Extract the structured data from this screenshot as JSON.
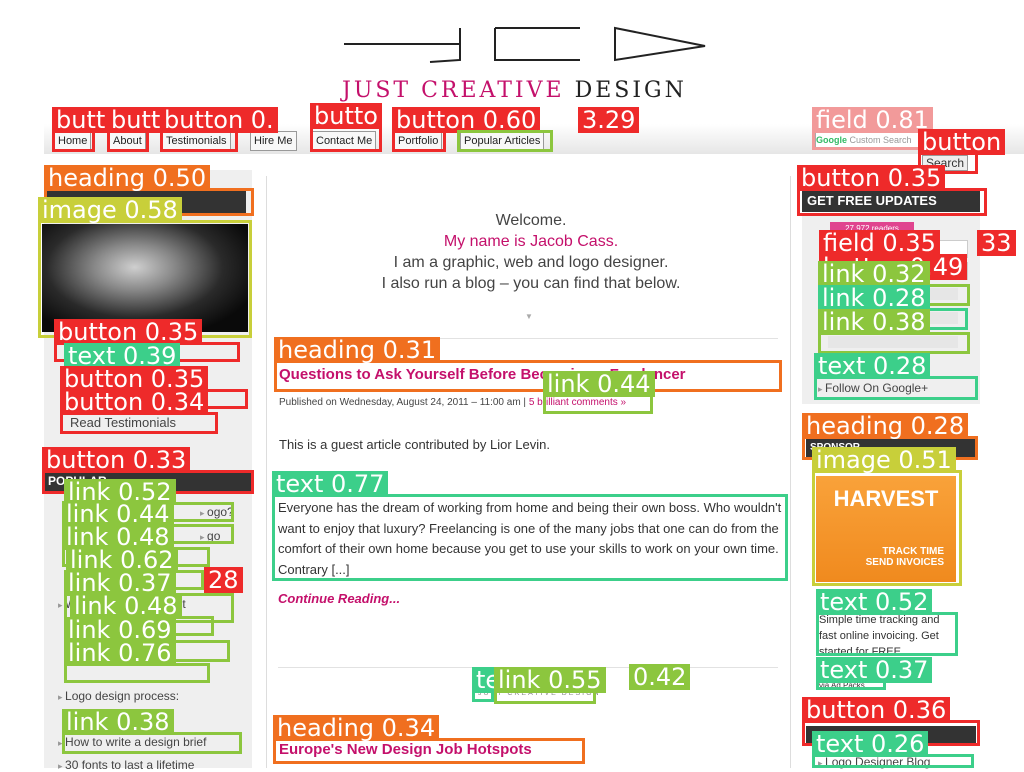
{
  "header": {
    "brand": "Just Creative Design"
  },
  "nav": {
    "items": [
      "Home",
      "About",
      "Testimonials",
      "Hire Me",
      "Contact Me",
      "Portfolio",
      "Popular Articles"
    ]
  },
  "search": {
    "placeholder": "Custom Search",
    "google_label": "Google",
    "button": "Search"
  },
  "left_sidebar": {
    "read_testimonials": "Read Testimonials",
    "popular_heading": "POPULAR",
    "popular_items": [
      "ogo?",
      "go",
      "Why logo design is not",
      "Logo design process:",
      "How to write a design brief",
      "30 fonts to last a lifetime"
    ]
  },
  "main": {
    "welcome": [
      "Welcome.",
      "My name is Jacob Cass.",
      "I am a graphic, web and logo designer.",
      "I also run a blog – you can find that below."
    ],
    "post1": {
      "title": "Questions to Ask Yourself Before Becoming a Freelancer",
      "meta": "Published on Wednesday, August 24, 2011 – 11:00 am",
      "comments": "5 brilliant comments »",
      "intro": "This is a guest article contributed by Lior Levin.",
      "body": "Everyone has the dream of working from home and being their own boss. Who wouldn't want to enjoy that luxury? Freelancing is one of the many jobs that one can do from the comfort of their own home because you get to use your skills to work on your own time. Contrary [...]",
      "continue": "Continue Reading..."
    },
    "divider_text": "JUST CREATIVE DESIGN",
    "post2": {
      "title": "Europe's New Design Job Hotspots"
    }
  },
  "right_sidebar": {
    "updates_heading": "GET FREE UPDATES",
    "rss_count": "27,972 readers",
    "google_plus": "Follow On Google+",
    "sponsor_heading": "SPONSOR",
    "harvest": {
      "brand": "HARVEST",
      "line1": "TRACK TIME",
      "line2": "SEND INVOICES"
    },
    "harvest_text": "Simple time tracking and fast online invoicing. Get started for FREE.",
    "ads_via": "via Ad Packs",
    "logo_blog": "Logo Designer Blog"
  },
  "overlays": [
    {
      "label": "butt",
      "color": "red"
    },
    {
      "label": "butt",
      "color": "red"
    },
    {
      "label": "button 0.",
      "color": "red"
    },
    {
      "label": "butto",
      "color": "red"
    },
    {
      "label": "button 0.60",
      "color": "red"
    },
    {
      "label": "3.29",
      "color": "lime"
    },
    {
      "label": "field 0.81",
      "color": "pink"
    },
    {
      "label": "button",
      "color": "red"
    },
    {
      "label": "heading 0.50",
      "color": "org"
    },
    {
      "label": "image 0.58",
      "color": "yel"
    },
    {
      "label": "button 0.35",
      "color": "red"
    },
    {
      "label": "text 0.39",
      "color": "green"
    },
    {
      "label": "button 0.35",
      "color": "red"
    },
    {
      "label": "button 0.34",
      "color": "red"
    },
    {
      "label": "button 0.33",
      "color": "red"
    },
    {
      "label": "link 0.52",
      "color": "lime"
    },
    {
      "label": "link 0.44",
      "color": "lime"
    },
    {
      "label": "link 0.48",
      "color": "lime"
    },
    {
      "label": "link 0.62",
      "color": "lime"
    },
    {
      "label": "link 0.37",
      "color": "lime"
    },
    {
      "label": "28",
      "color": "red"
    },
    {
      "label": "link 0.48",
      "color": "lime"
    },
    {
      "label": "link 0.69",
      "color": "lime"
    },
    {
      "label": "link 0.76",
      "color": "lime"
    },
    {
      "label": "link 0.38",
      "color": "lime"
    },
    {
      "label": "heading 0.31",
      "color": "org"
    },
    {
      "label": "link 0.44",
      "color": "lime"
    },
    {
      "label": "text 0.77",
      "color": "green"
    },
    {
      "label": "te",
      "color": "green"
    },
    {
      "label": "link 0.55",
      "color": "lime"
    },
    {
      "label": "0.42",
      "color": "lime"
    },
    {
      "label": "heading 0.34",
      "color": "org"
    },
    {
      "label": "button 0.35",
      "color": "red"
    },
    {
      "label": "field 0.35",
      "color": "red"
    },
    {
      "label": "33",
      "color": "red"
    },
    {
      "label": "button 0.49",
      "color": "red"
    },
    {
      "label": "link 0.32",
      "color": "lime"
    },
    {
      "label": "link 0.28",
      "color": "green"
    },
    {
      "label": "link 0.38",
      "color": "lime"
    },
    {
      "label": "text 0.28",
      "color": "green"
    },
    {
      "label": "heading 0.28",
      "color": "org"
    },
    {
      "label": "image 0.51",
      "color": "yel"
    },
    {
      "label": "text 0.52",
      "color": "green"
    },
    {
      "label": "text 0.37",
      "color": "green"
    },
    {
      "label": "button 0.36",
      "color": "red"
    },
    {
      "label": "text 0.26",
      "color": "green"
    }
  ]
}
